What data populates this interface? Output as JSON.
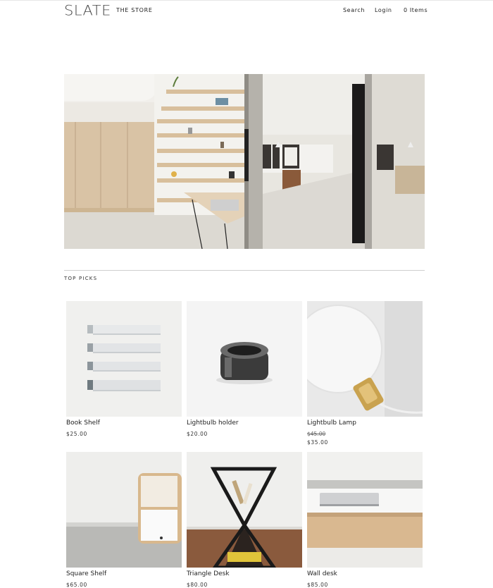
{
  "header": {
    "logo": "SLATE",
    "store_label": "THE STORE",
    "nav": {
      "search": "Search",
      "login": "Login",
      "cart": "0 Items"
    }
  },
  "section": {
    "title": "TOP PICKS"
  },
  "products": [
    {
      "name": "Book Shelf",
      "price": "$25.00"
    },
    {
      "name": "Lightbulb holder",
      "price": "$20.00"
    },
    {
      "name": "Lightbulb Lamp",
      "old_price": "$45.00",
      "price": "$35.00"
    },
    {
      "name": "Square Shelf",
      "price": "$65.00"
    },
    {
      "name": "Triangle Desk",
      "price": "$80.00"
    },
    {
      "name": "Wall desk",
      "price": "$85.00"
    }
  ]
}
